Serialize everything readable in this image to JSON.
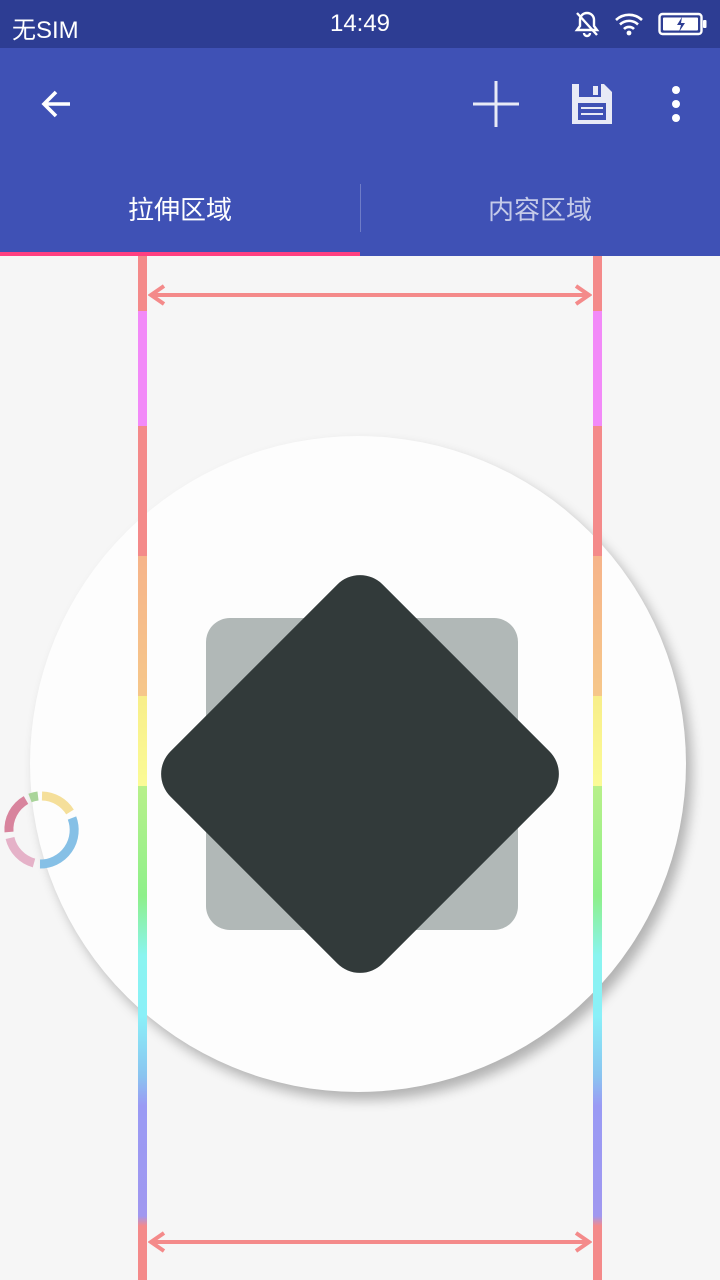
{
  "status_bar": {
    "carrier": "无SIM",
    "time": "14:49",
    "icons": [
      "bell-off-icon",
      "wifi-icon",
      "battery-charging-icon"
    ]
  },
  "toolbar": {
    "icons": [
      "back-arrow-icon",
      "add-icon",
      "save-icon",
      "more-vert-icon"
    ],
    "color": "#3f51b5"
  },
  "tabs": [
    {
      "label": "拉伸区域",
      "selected": true
    },
    {
      "label": "内容区域",
      "selected": false
    }
  ],
  "colors": {
    "status_bar": "#2d3d93",
    "toolbar": "#3f51b5",
    "tab_indicator": "#ff4081",
    "diamond": "#323a3a",
    "rounded_square": "#b1b8b7",
    "guide_arrow": "#f48a8a"
  },
  "canvas": {
    "icons": [
      "adaptive-icon-circle",
      "stretch-guide-arrow-icon",
      "floating-ring-icon"
    ]
  }
}
